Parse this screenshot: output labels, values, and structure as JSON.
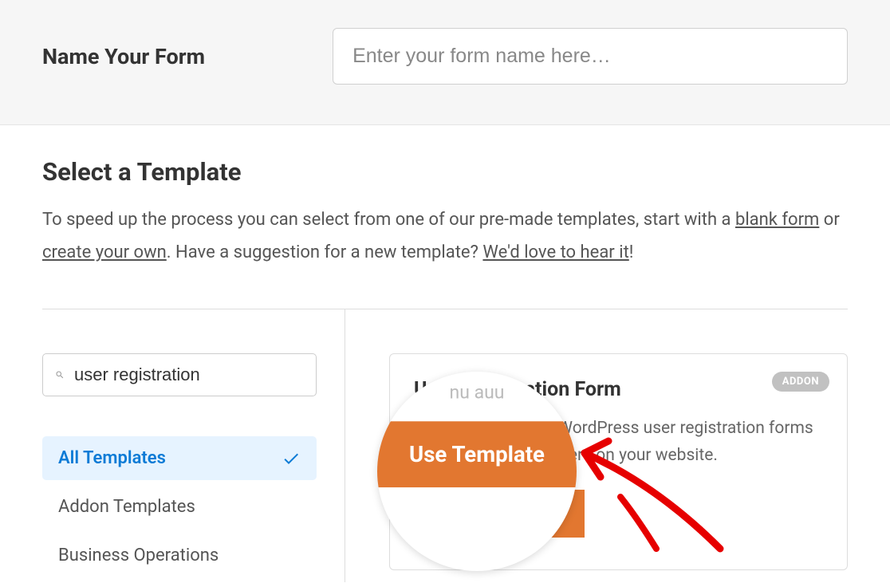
{
  "form_name": {
    "label": "Name Your Form",
    "placeholder": "Enter your form name here…"
  },
  "template_section": {
    "heading": "Select a Template",
    "desc_part1": "To speed up the process you can select from one of our pre-made templates, start with a ",
    "link_blank": "blank form",
    "desc_part2": " or ",
    "link_create": "create your own",
    "desc_part3": ". Have a suggestion for a new template? ",
    "link_feedback": "We'd love to hear it",
    "desc_part4": "!"
  },
  "search": {
    "value": "user registration"
  },
  "categories": [
    {
      "label": "All Templates",
      "active": true
    },
    {
      "label": "Addon Templates",
      "active": false
    },
    {
      "label": "Business Operations",
      "active": false
    }
  ],
  "template_card": {
    "badge": "ADDON",
    "title": "User Registration Form",
    "description": "Create customized WordPress user registration forms and add them anywhere on your website.",
    "button": "Use Template"
  },
  "magnifier": {
    "faded_text": "nu auu",
    "button": "Use Template"
  }
}
